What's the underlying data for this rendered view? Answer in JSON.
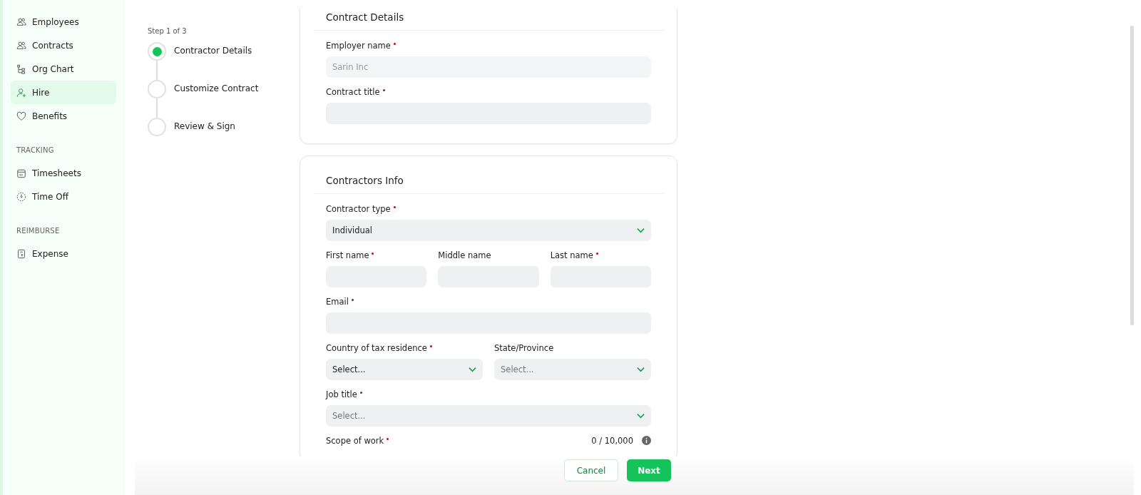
{
  "sidebar": {
    "sections": [
      {
        "items": [
          {
            "label": "Employees",
            "selected": false
          },
          {
            "label": "Contracts",
            "selected": false
          },
          {
            "label": "Org Chart",
            "selected": false
          },
          {
            "label": "Hire",
            "selected": true
          },
          {
            "label": "Benefits",
            "selected": false
          }
        ]
      },
      {
        "heading": "TRACKING",
        "items": [
          {
            "label": "Timesheets",
            "selected": false
          },
          {
            "label": "Time Off",
            "selected": false
          }
        ]
      },
      {
        "heading": "REIMBURSE",
        "items": [
          {
            "label": "Expense",
            "selected": false
          }
        ]
      }
    ]
  },
  "stepper": {
    "caption": "Step 1 of 3",
    "steps": [
      {
        "label": "Contractor Details",
        "selected": true
      },
      {
        "label": "Customize Contract",
        "selected": false
      },
      {
        "label": "Review & Sign",
        "selected": false
      }
    ]
  },
  "cards": [
    {
      "title": "Contract Details",
      "rows": [
        [
          {
            "label": "Employer name",
            "required": true,
            "kind": "text",
            "value": "Sarin Inc",
            "disabled": true
          }
        ],
        [
          {
            "label": "Contract title",
            "required": true,
            "kind": "text"
          }
        ]
      ]
    },
    {
      "title": "Contractors Info",
      "rows": [
        [
          {
            "label": "Contractor type",
            "required": true,
            "kind": "select",
            "value": "Individual"
          }
        ],
        [
          {
            "label": "First name",
            "required": true,
            "kind": "text"
          },
          {
            "label": "Middle name",
            "required": false,
            "kind": "text"
          },
          {
            "label": "Last name",
            "required": true,
            "kind": "text"
          }
        ],
        [
          {
            "label": "Email",
            "required": true,
            "kind": "text"
          }
        ],
        [
          {
            "label": "Country of tax residence",
            "required": true,
            "kind": "select",
            "value": "Select..."
          },
          {
            "label": "State/Province",
            "required": false,
            "kind": "select",
            "placeholder": "Select..."
          }
        ],
        [
          {
            "label": "Job title",
            "required": true,
            "kind": "select",
            "placeholder": "Select..."
          }
        ],
        [
          {
            "label": "Scope of work",
            "required": true,
            "kind": "counter",
            "counter": "0 / 10,000"
          }
        ]
      ]
    }
  ],
  "footer": {
    "buttons": [
      {
        "label": "Cancel",
        "kind": "secondary"
      },
      {
        "label": "Next",
        "kind": "primary"
      }
    ]
  }
}
